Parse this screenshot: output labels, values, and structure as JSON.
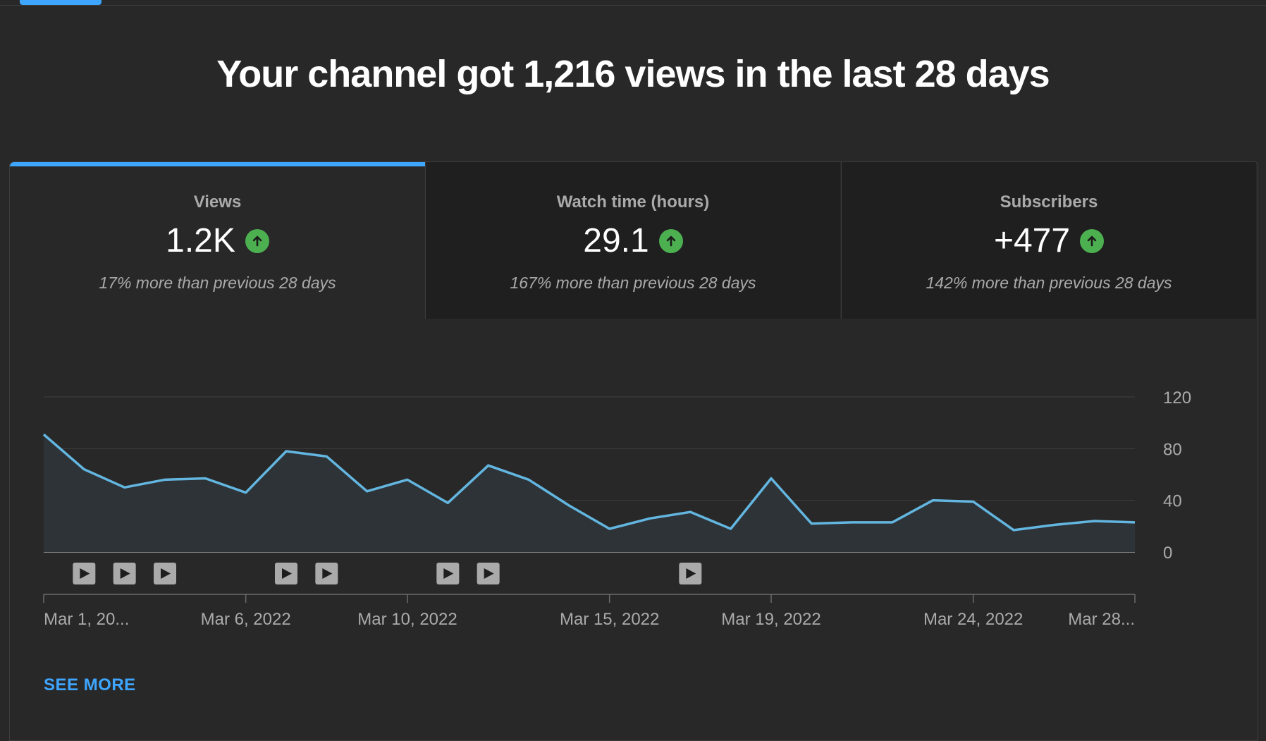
{
  "headline": "Your channel got 1,216 views in the last 28 days",
  "metrics": [
    {
      "label": "Views",
      "value": "1.2K",
      "compare": "17% more than previous 28 days",
      "trend_icon": "arrow-up-circle-icon",
      "active": true
    },
    {
      "label": "Watch time (hours)",
      "value": "29.1",
      "compare": "167% more than previous 28 days",
      "trend_icon": "arrow-up-circle-icon",
      "active": false
    },
    {
      "label": "Subscribers",
      "value": "+477",
      "compare": "142% more than previous 28 days",
      "trend_icon": "arrow-up-circle-icon",
      "active": false
    }
  ],
  "colors": {
    "accent": "#3ea6ff",
    "line": "#63b6e0",
    "trend_up": "#4caf50",
    "background": "#282828"
  },
  "chart_data": {
    "type": "area",
    "x": [
      "Mar 1, 2022",
      "Mar 2, 2022",
      "Mar 3, 2022",
      "Mar 4, 2022",
      "Mar 5, 2022",
      "Mar 6, 2022",
      "Mar 7, 2022",
      "Mar 8, 2022",
      "Mar 9, 2022",
      "Mar 10, 2022",
      "Mar 11, 2022",
      "Mar 12, 2022",
      "Mar 13, 2022",
      "Mar 14, 2022",
      "Mar 15, 2022",
      "Mar 16, 2022",
      "Mar 17, 2022",
      "Mar 18, 2022",
      "Mar 19, 2022",
      "Mar 20, 2022",
      "Mar 21, 2022",
      "Mar 22, 2022",
      "Mar 23, 2022",
      "Mar 24, 2022",
      "Mar 25, 2022",
      "Mar 26, 2022",
      "Mar 27, 2022",
      "Mar 28, 2022"
    ],
    "values": [
      91,
      64,
      50,
      56,
      57,
      46,
      78,
      74,
      47,
      56,
      38,
      67,
      56,
      36,
      18,
      26,
      31,
      18,
      57,
      22,
      23,
      23,
      40,
      39,
      17,
      21,
      24,
      23
    ],
    "ylim": [
      0,
      120
    ],
    "y_ticks": [
      "120",
      "80",
      "40",
      "0"
    ],
    "y_tick_values": [
      120,
      80,
      40,
      0
    ],
    "x_tick_labels": [
      "Mar 1, 20...",
      "Mar 6, 2022",
      "Mar 10, 2022",
      "Mar 15, 2022",
      "Mar 19, 2022",
      "Mar 24, 2022",
      "Mar 28..."
    ],
    "x_tick_indices": [
      0,
      5,
      9,
      14,
      18,
      23,
      27
    ],
    "video_markers_at": [
      1,
      2,
      3,
      6,
      7,
      10,
      11,
      16
    ],
    "grid": true
  },
  "see_more": "SEE MORE"
}
